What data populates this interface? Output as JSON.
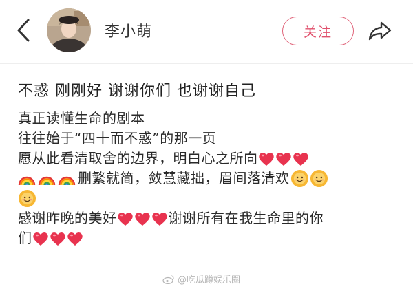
{
  "header": {
    "username": "李小萌",
    "follow_label": "关注"
  },
  "post": {
    "title": "不惑 刚刚好 谢谢你们 也谢谢自己",
    "lines": {
      "l1": "真正读懂生命的剧本",
      "l2": "往往始于“四十而不惑”的那一页",
      "l3": "愿从此看清取舍的边界，明白心之所向",
      "l4": "删繁就简，敛慧藏拙，眉间落清欢",
      "l6a": "感谢昨晚的美好",
      "l6b": "谢谢所有在我生命里的你",
      "l7": "们"
    },
    "emojis": [
      "heart-emoji",
      "rainbow-emoji",
      "sun-smile-emoji"
    ]
  },
  "watermark": {
    "text": "@吃瓜蹲娱乐圈"
  },
  "colors": {
    "accent": "#e0506c",
    "heart": "#e8334f",
    "text": "#222222"
  }
}
